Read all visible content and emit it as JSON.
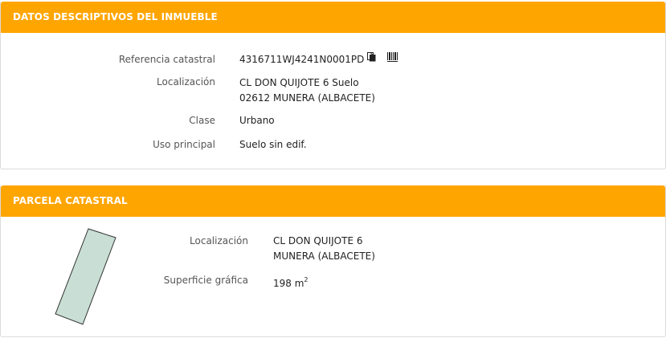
{
  "section1": {
    "title": "DATOS DESCRIPTIVOS DEL INMUEBLE",
    "referencia_label": "Referencia catastral",
    "referencia_value": "4316711WJ4241N0001PD",
    "localizacion_label": "Localización",
    "localizacion_line1": "CL DON QUIJOTE 6 Suelo",
    "localizacion_line2": "02612 MUNERA (ALBACETE)",
    "clase_label": "Clase",
    "clase_value": "Urbano",
    "uso_label": "Uso principal",
    "uso_value": "Suelo sin edif."
  },
  "section2": {
    "title": "PARCELA CATASTRAL",
    "localizacion_label": "Localización",
    "localizacion_line1": "CL DON QUIJOTE 6",
    "localizacion_line2": "MUNERA (ALBACETE)",
    "superficie_label": "Superficie gráfica",
    "superficie_value": "198 m",
    "superficie_unit_sup": "2"
  },
  "icons": {
    "copy": "copy-icon",
    "barcode": "barcode-icon"
  },
  "colors": {
    "header": "#ffa500",
    "parcel_fill": "#c9dfd5"
  }
}
